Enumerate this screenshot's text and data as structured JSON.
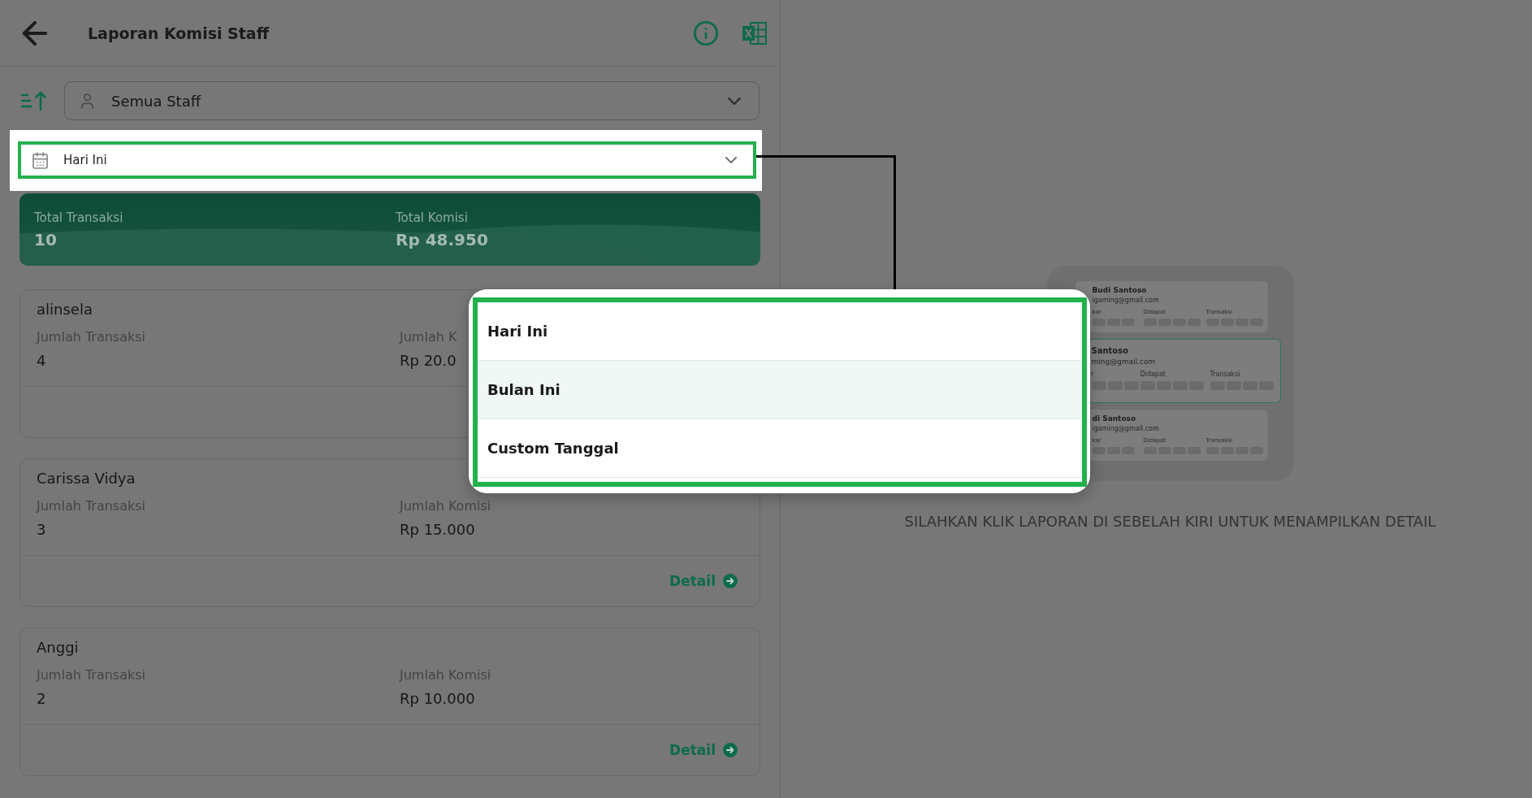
{
  "header": {
    "title": "Laporan Komisi Staff"
  },
  "filters": {
    "staff_select": {
      "value": "Semua Staff"
    },
    "date_select": {
      "value": "Hari Ini",
      "highlighted": true
    }
  },
  "summary": [
    {
      "label": "Total Transaksi",
      "value": "10"
    },
    {
      "label": "Total Komisi",
      "value": "Rp 48.950"
    }
  ],
  "staff_cards": [
    {
      "name": "alinsela",
      "fields": [
        {
          "label": "Jumlah Transaksi",
          "value": "4"
        },
        {
          "label": "Jumlah K",
          "value": "Rp 20.0"
        }
      ]
    },
    {
      "name": "Carissa Vidya",
      "fields": [
        {
          "label": "Jumlah Transaksi",
          "value": "3"
        },
        {
          "label": "Jumlah Komisi",
          "value": "Rp 15.000"
        }
      ],
      "action": "Detail"
    },
    {
      "name": "Anggi",
      "fields": [
        {
          "label": "Jumlah Transaksi",
          "value": "2"
        },
        {
          "label": "Jumlah Komisi",
          "value": "Rp 10.000"
        }
      ],
      "action": "Detail"
    }
  ],
  "date_dropdown": {
    "options": [
      {
        "label": "Hari Ini",
        "highlighted": false
      },
      {
        "label": "Bulan Ini",
        "highlighted": true
      },
      {
        "label": "Custom Tanggal",
        "highlighted": false
      }
    ]
  },
  "empty_state": {
    "illustration": {
      "cards": [
        {
          "name": "Budi Santoso",
          "email": "igaming@gmail.com",
          "columns": [
            "kar",
            "Didapat",
            "Transaksi"
          ],
          "active": false
        },
        {
          "name": "Santoso",
          "email": "ming@gmail.com",
          "columns": [
            "r",
            "Didapat",
            "Transaksi"
          ],
          "active": true
        },
        {
          "name": "di Santoso",
          "email": "igaming@gmail.com",
          "columns": [
            "kar",
            "Didapat",
            "Transaksi"
          ],
          "active": false
        }
      ]
    },
    "message": "SILAHKAN KLIK LAPORAN DI SEBELAH KIRI UNTUK MENAMPILKAN DETAIL"
  }
}
